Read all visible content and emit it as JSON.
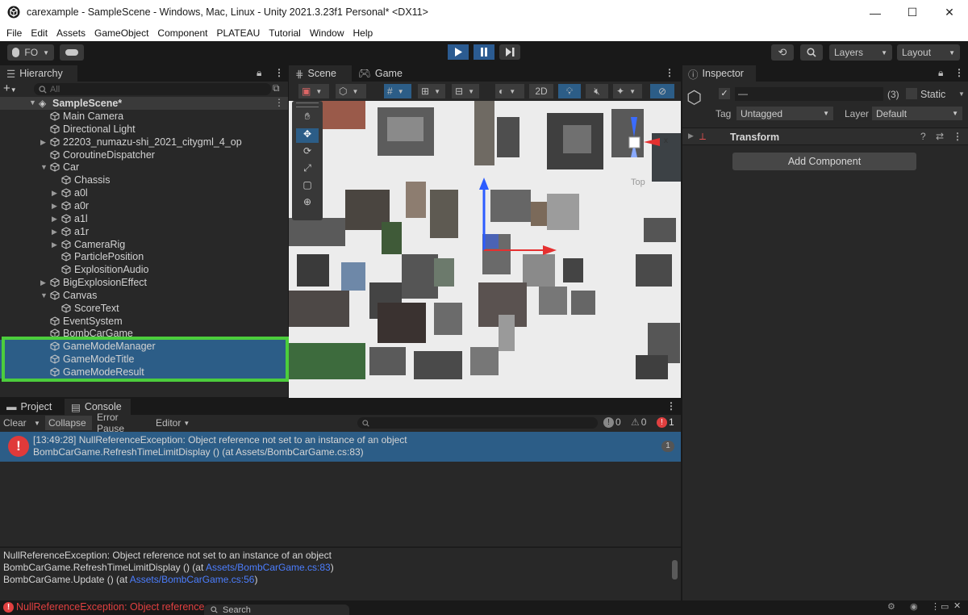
{
  "window": {
    "title": "carexample - SampleScene - Windows, Mac, Linux - Unity 2021.3.23f1 Personal* <DX11>",
    "controls": {
      "minimize": "—",
      "maximize": "☐",
      "close": "✕"
    }
  },
  "menu": [
    "File",
    "Edit",
    "Assets",
    "GameObject",
    "Component",
    "PLATEAU",
    "Tutorial",
    "Window",
    "Help"
  ],
  "toolbar": {
    "account": "FO",
    "layers_label": "Layers",
    "layout_label": "Layout"
  },
  "hierarchy": {
    "tab": "Hierarchy",
    "search_placeholder": "All",
    "scene": "SampleScene*",
    "items": [
      {
        "label": "Main Camera",
        "depth": 1,
        "arrow": ""
      },
      {
        "label": "Directional Light",
        "depth": 1,
        "arrow": ""
      },
      {
        "label": "22203_numazu-shi_2021_citygml_4_op",
        "depth": 1,
        "arrow": "right"
      },
      {
        "label": "CoroutineDispatcher",
        "depth": 1,
        "arrow": ""
      },
      {
        "label": "Car",
        "depth": 1,
        "arrow": "down"
      },
      {
        "label": "Chassis",
        "depth": 2,
        "arrow": ""
      },
      {
        "label": "a0l",
        "depth": 2,
        "arrow": "right"
      },
      {
        "label": "a0r",
        "depth": 2,
        "arrow": "right"
      },
      {
        "label": "a1l",
        "depth": 2,
        "arrow": "right"
      },
      {
        "label": "a1r",
        "depth": 2,
        "arrow": "right"
      },
      {
        "label": "CameraRig",
        "depth": 2,
        "arrow": "right"
      },
      {
        "label": "ParticlePosition",
        "depth": 2,
        "arrow": ""
      },
      {
        "label": "ExplositionAudio",
        "depth": 2,
        "arrow": ""
      },
      {
        "label": "BigExplosionEffect",
        "depth": 1,
        "arrow": "right"
      },
      {
        "label": "Canvas",
        "depth": 1,
        "arrow": "down"
      },
      {
        "label": "ScoreText",
        "depth": 2,
        "arrow": ""
      },
      {
        "label": "EventSystem",
        "depth": 1,
        "arrow": ""
      },
      {
        "label": "BombCarGame",
        "depth": 1,
        "arrow": ""
      },
      {
        "label": "GameModeManager",
        "depth": 1,
        "arrow": "",
        "selected": true
      },
      {
        "label": "GameModeTitle",
        "depth": 1,
        "arrow": "",
        "selected": true
      },
      {
        "label": "GameModeResult",
        "depth": 1,
        "arrow": "",
        "selected": true
      }
    ],
    "highlight_color": "#4ccd3c"
  },
  "scene_view": {
    "tabs": [
      "Scene",
      "Game"
    ],
    "mode_2d": "2D",
    "gizmo_label": "Top",
    "gizmo_x": "x"
  },
  "inspector": {
    "tab": "Inspector",
    "name_value": "—",
    "count": "(3)",
    "static_label": "Static",
    "tag_label": "Tag",
    "tag_value": "Untagged",
    "layer_label": "Layer",
    "layer_value": "Default",
    "component": "Transform",
    "add_component": "Add Component"
  },
  "console": {
    "tabs": [
      "Project",
      "Console"
    ],
    "clear": "Clear",
    "collapse": "Collapse",
    "error_pause": "Error Pause",
    "editor": "Editor",
    "counts": {
      "info": "0",
      "warn": "0",
      "error": "1"
    },
    "entry_line1": "[13:49:28] NullReferenceException: Object reference not set to an instance of an object",
    "entry_line2": "BombCarGame.RefreshTimeLimitDisplay () (at Assets/BombCarGame.cs:83)",
    "entry_count": "1",
    "detail_line1": "NullReferenceException: Object reference not set to an instance of an object",
    "detail_line2_pre": "BombCarGame.RefreshTimeLimitDisplay () (at ",
    "detail_line2_link": "Assets/BombCarGame.cs:83",
    "detail_line2_post": ")",
    "detail_line3_pre": "BombCarGame.Update () (at ",
    "detail_line3_link": "Assets/BombCarGame.cs:56",
    "detail_line3_post": ")"
  },
  "statusbar": {
    "message": "NullReferenceException: Object reference",
    "search": "Search"
  },
  "colors": {
    "accent": "#2c5d87",
    "error": "#e04040",
    "link": "#4c7eff"
  }
}
